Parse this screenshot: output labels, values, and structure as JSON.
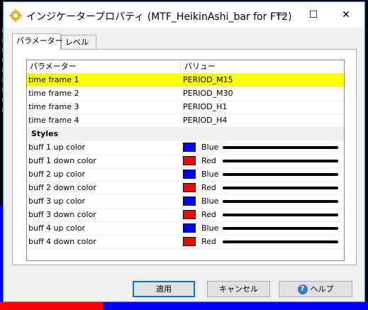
{
  "window": {
    "title": "インジケータープロパティ (MTF_HeikinAshi_bar for FT2)",
    "minimize_glyph": "—",
    "maximize_glyph": "☐",
    "close_glyph": "✕"
  },
  "tabs": [
    {
      "label": "パラメーター",
      "active": true
    },
    {
      "label": "レベル",
      "active": false
    }
  ],
  "grid": {
    "columns": [
      "パラメーター",
      "バリュー"
    ],
    "rows": [
      {
        "name": "time frame 1",
        "value": "PERIOD_M15",
        "selected": true
      },
      {
        "name": "time frame 2",
        "value": "PERIOD_M30"
      },
      {
        "name": "time frame 3",
        "value": "PERIOD_H1"
      },
      {
        "name": "time frame 4",
        "value": "PERIOD_H4"
      }
    ],
    "group_label": "Styles",
    "colors": [
      {
        "name": "buff 1 up color",
        "color_name": "Blue",
        "hex": "#0000ff"
      },
      {
        "name": "buff 1 down color",
        "color_name": "Red",
        "hex": "#ff0000"
      },
      {
        "name": "buff 2 up color",
        "color_name": "Blue",
        "hex": "#0000ff"
      },
      {
        "name": "buff 2 down color",
        "color_name": "Red",
        "hex": "#ff0000"
      },
      {
        "name": "buff 3 up color",
        "color_name": "Blue",
        "hex": "#0000ff"
      },
      {
        "name": "buff 3 down color",
        "color_name": "Red",
        "hex": "#ff0000"
      },
      {
        "name": "buff 4 up color",
        "color_name": "Blue",
        "hex": "#0000ff"
      },
      {
        "name": "buff 4 down color",
        "color_name": "Red",
        "hex": "#ff0000"
      }
    ]
  },
  "buttons": {
    "ok": "適用",
    "cancel": "キャンセル",
    "help": "ヘルプ",
    "help_icon_glyph": "?"
  },
  "colors": {
    "selection": "#ffff00",
    "accent": "#0078d7"
  }
}
